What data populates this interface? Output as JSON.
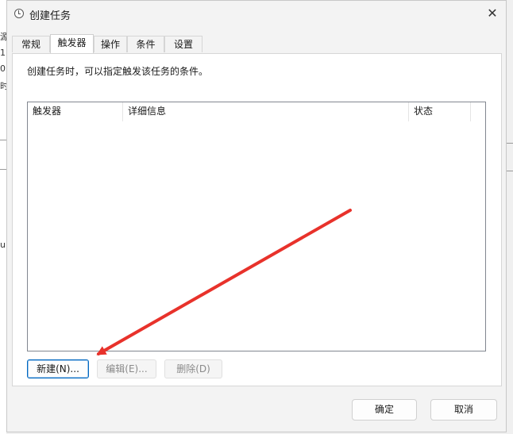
{
  "window": {
    "title": "创建任务"
  },
  "tabs": [
    {
      "label": "常规"
    },
    {
      "label": "触发器"
    },
    {
      "label": "操作"
    },
    {
      "label": "条件"
    },
    {
      "label": "设置"
    }
  ],
  "active_tab": "触发器",
  "panel": {
    "description": "创建任务时，可以指定触发该任务的条件。"
  },
  "list": {
    "columns": [
      {
        "label": "触发器"
      },
      {
        "label": "详细信息"
      },
      {
        "label": "状态"
      }
    ],
    "rows": []
  },
  "buttons": {
    "new": "新建(N)...",
    "edit": "编辑(E)...",
    "delete": "删除(D)"
  },
  "footer": {
    "ok": "确定",
    "cancel": "取消"
  },
  "annotation": {
    "arrow_color": "#e8322b"
  },
  "background_fragments": [
    "源",
    "1",
    "0",
    "时",
    "u"
  ],
  "colors": {
    "accent": "#0067c0"
  }
}
